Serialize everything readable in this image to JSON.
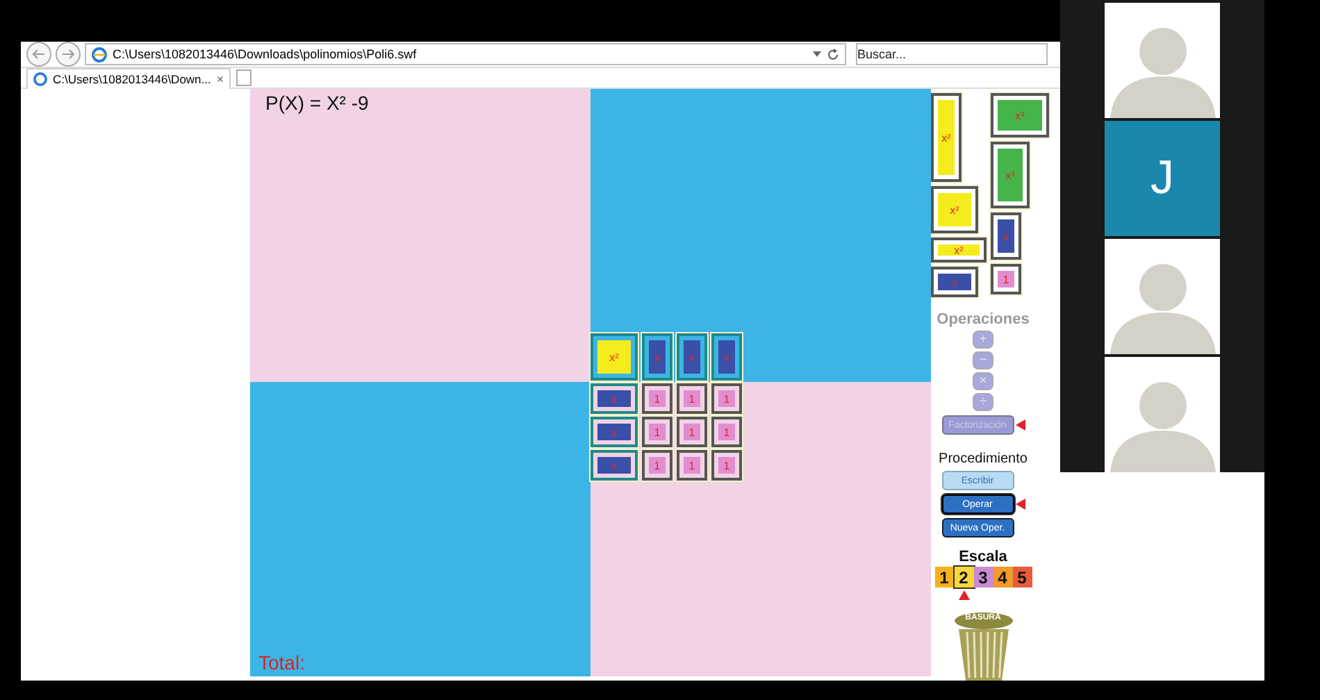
{
  "browser": {
    "address": "C:\\Users\\1082013446\\Downloads\\polinomios\\Poli6.swf",
    "search": {
      "placeholder": "Buscar..."
    },
    "tabs": [
      {
        "label": "C:\\Users\\1082013446\\Down...",
        "selected": true,
        "close": "×"
      }
    ]
  },
  "app": {
    "polynomial": "P(X) =  X² -9",
    "total_label": "Total:",
    "board": [
      [
        {
          "kind": "x2square",
          "label": "x²"
        },
        {
          "kind": "xvertical",
          "label": "x"
        },
        {
          "kind": "xvertical",
          "label": "x"
        },
        {
          "kind": "xvertical",
          "label": "x"
        }
      ],
      [
        {
          "kind": "xhorizontal",
          "label": "x"
        },
        {
          "kind": "one",
          "label": "1"
        },
        {
          "kind": "one",
          "label": "1"
        },
        {
          "kind": "one",
          "label": "1"
        }
      ],
      [
        {
          "kind": "xhorizontal",
          "label": "x"
        },
        {
          "kind": "one",
          "label": "1"
        },
        {
          "kind": "one",
          "label": "1"
        },
        {
          "kind": "one",
          "label": "1"
        }
      ],
      [
        {
          "kind": "xhorizontal",
          "label": "x"
        },
        {
          "kind": "one",
          "label": "1"
        },
        {
          "kind": "one",
          "label": "1"
        },
        {
          "kind": "one",
          "label": "1"
        }
      ]
    ],
    "palette": [
      [
        {
          "kind": "x2vertical",
          "label": "x²"
        },
        {
          "kind": "x2square",
          "label": "x²"
        },
        {
          "kind": "x2horizontal",
          "label": "x²"
        },
        {
          "kind": "xhorizontal",
          "label": "x"
        }
      ],
      [
        {
          "kind": "x3horizontal",
          "label": "x³"
        },
        {
          "kind": "x3vertical",
          "label": "x³"
        },
        {
          "kind": "xvertical",
          "label": "x"
        },
        {
          "kind": "one",
          "label": "1"
        }
      ]
    ],
    "operations": {
      "title": "Operaciones",
      "buttons": [
        {
          "label": "+",
          "disabled": true
        },
        {
          "label": "−",
          "disabled": true
        },
        {
          "label": "×",
          "disabled": true
        },
        {
          "label": "÷",
          "disabled": true
        }
      ],
      "factorization": {
        "label": "Factorización",
        "disabled": true,
        "selected": true
      }
    },
    "procedure": {
      "title": "Procedimiento",
      "buttons": [
        {
          "label": "Escribir",
          "kind": "light",
          "selected": false
        },
        {
          "label": "Operar",
          "kind": "dark",
          "selected": true
        },
        {
          "label": "Nueva Oper.",
          "kind": "dark",
          "selected": false
        }
      ]
    },
    "scale": {
      "title": "Escala",
      "levels": [
        {
          "label": "1",
          "color": "#f5b21b",
          "selected": false
        },
        {
          "label": "2",
          "color": "#f7d83a",
          "selected": true
        },
        {
          "label": "3",
          "color": "#c98bd2",
          "selected": false
        },
        {
          "label": "4",
          "color": "#f39a2a",
          "selected": false
        },
        {
          "label": "5",
          "color": "#ea5a3c",
          "selected": false
        }
      ]
    },
    "trash": {
      "label": "BASURA"
    }
  },
  "video_call": {
    "participants": [
      {
        "kind": "avatar"
      },
      {
        "kind": "initial",
        "initial": "J"
      },
      {
        "kind": "avatar"
      },
      {
        "kind": "avatar"
      }
    ]
  }
}
